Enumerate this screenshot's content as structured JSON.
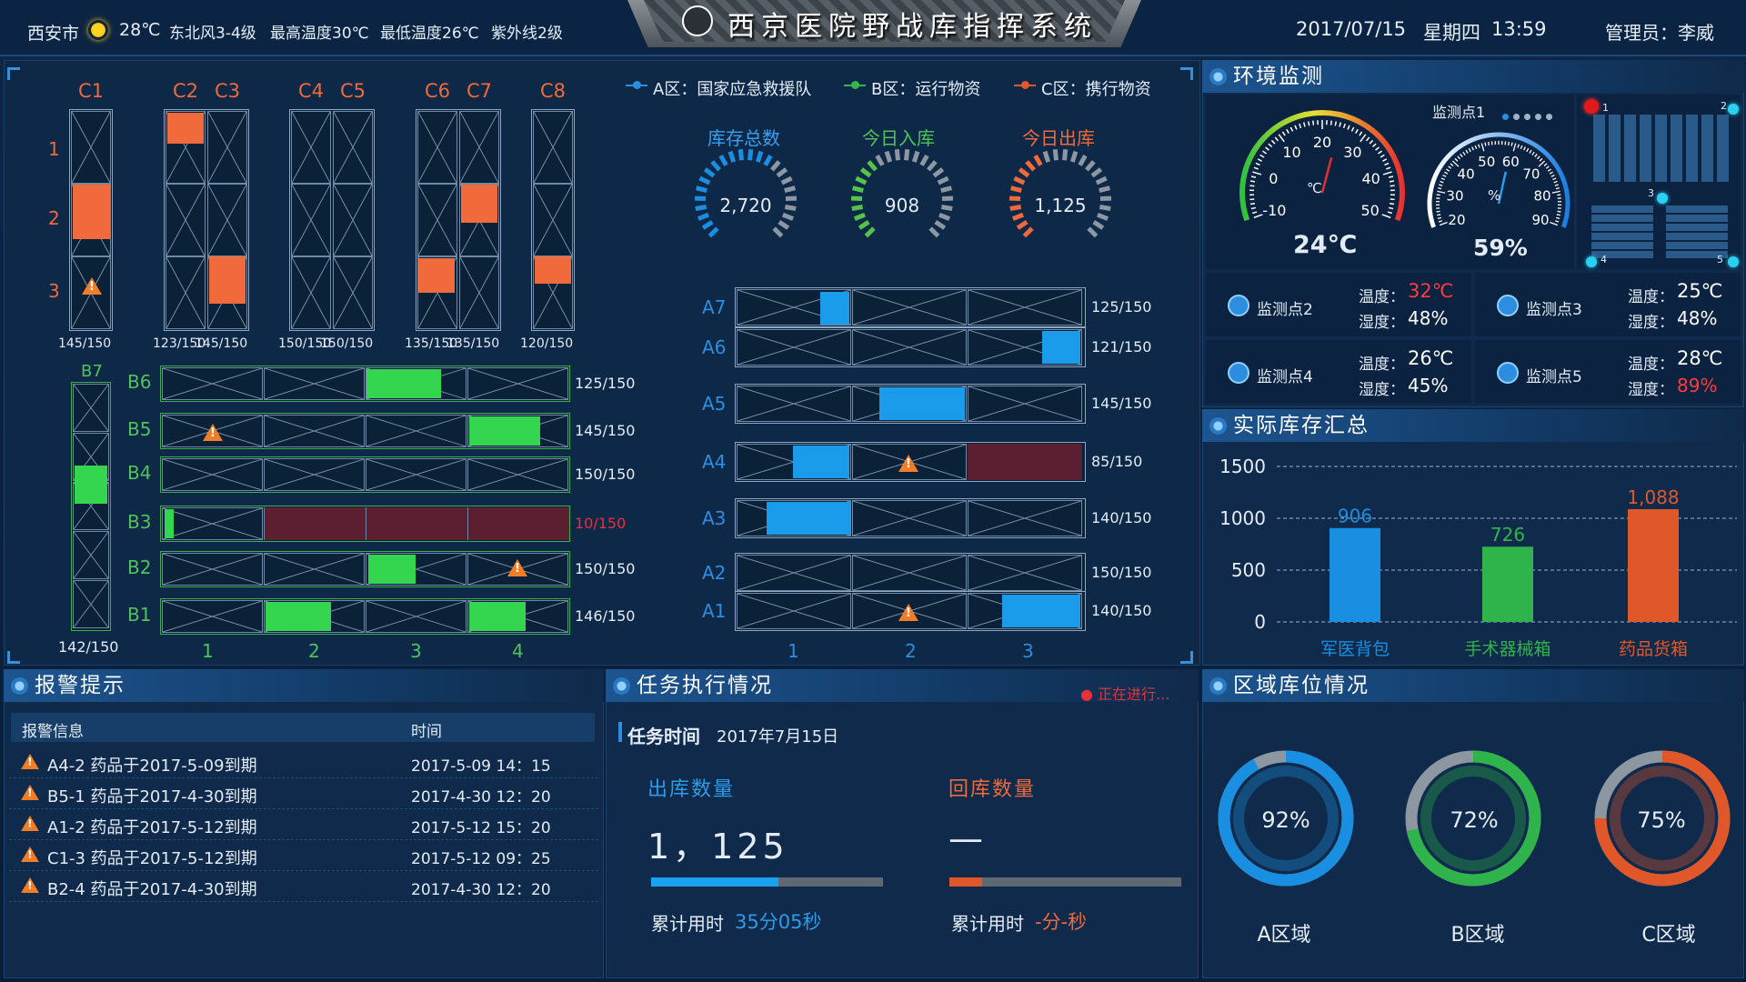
{
  "header": {
    "city": "西安市",
    "temp": "28℃",
    "wind": "东北风3-4级",
    "max": "最高温度30℃",
    "min": "最低温度26℃",
    "uv": "紫外线2级",
    "title": "西京医院野战库指挥系统",
    "date": "2017/07/15",
    "weekday": "星期四",
    "time": "13:59",
    "admin": "管理员：李威"
  },
  "legend": {
    "a": "A区：国家应急救援队",
    "b": "B区：运行物资",
    "c": "C区：携行物资"
  },
  "c_racks": {
    "top_labels": [
      "C1",
      "C2",
      "C3",
      "C4",
      "C5",
      "C6",
      "C7",
      "C8"
    ],
    "row_labels": [
      "1",
      "2",
      "3"
    ],
    "caps": [
      "145/150",
      "123/150",
      "145/150",
      "150/150",
      "150/150",
      "135/150",
      "135/150",
      "120/150"
    ]
  },
  "b_rows": {
    "labels": [
      "B6",
      "B5",
      "B4",
      "B3",
      "B2",
      "B1"
    ],
    "caps": [
      "125/150",
      "145/150",
      "150/150",
      "10/150",
      "150/150",
      "146/150"
    ],
    "col_labels": [
      "1",
      "2",
      "3",
      "4"
    ],
    "b7": "B7",
    "b7_cap": "142/150"
  },
  "a_rows": {
    "labels": [
      "A7",
      "A6",
      "A5",
      "A4",
      "A3",
      "A2",
      "A1"
    ],
    "caps": [
      "125/150",
      "121/150",
      "145/150",
      "85/150",
      "140/150",
      "150/150",
      "140/150"
    ],
    "col_labels": [
      "1",
      "2",
      "3"
    ]
  },
  "kpi": {
    "total_label": "库存总数",
    "total": "2,720",
    "in_label": "今日入库",
    "in": "908",
    "out_label": "今日出库",
    "out": "1,125"
  },
  "env": {
    "title": "环境监测",
    "point": "监测点1",
    "temp": "24℃",
    "humid": "59%",
    "temp_ticks": [
      "-10",
      "0",
      "10",
      "20",
      "30",
      "40",
      "50"
    ],
    "temp_unit": "℃",
    "hum_ticks": [
      "20",
      "30",
      "40",
      "50",
      "60",
      "70",
      "80",
      "90"
    ],
    "hum_unit": "%",
    "map_labels": [
      "1",
      "2",
      "3",
      "4",
      "5"
    ],
    "points": [
      {
        "name": "监测点2",
        "t_label": "温度：",
        "t": "32℃",
        "h_label": "湿度：",
        "h": "48%",
        "t_color": "#ff3b3b",
        "h_color": "#ffffff"
      },
      {
        "name": "监测点3",
        "t_label": "温度：",
        "t": "25℃",
        "h_label": "湿度：",
        "h": "48%",
        "t_color": "#ffffff",
        "h_color": "#ffffff"
      },
      {
        "name": "监测点4",
        "t_label": "温度：",
        "t": "26℃",
        "h_label": "湿度：",
        "h": "45%",
        "t_color": "#ffffff",
        "h_color": "#ffffff"
      },
      {
        "name": "监测点5",
        "t_label": "温度：",
        "t": "28℃",
        "h_label": "湿度：",
        "h": "89%",
        "t_color": "#ffffff",
        "h_color": "#ff3b3b"
      }
    ]
  },
  "inventory": {
    "title": "实际库存汇总"
  },
  "chart_data": {
    "type": "bar",
    "categories": [
      "军医背包",
      "手术器械箱",
      "药品货箱"
    ],
    "values": [
      906,
      726,
      1088
    ],
    "value_labels": [
      "906",
      "726",
      "1,088"
    ],
    "colors": [
      "#1a8ee0",
      "#2fb34b",
      "#e0572a"
    ],
    "yticks": [
      "0",
      "500",
      "1000",
      "1500"
    ],
    "ylim": [
      0,
      1500
    ]
  },
  "alarm": {
    "title": "报警提示",
    "col_info": "报警信息",
    "col_time": "时间",
    "rows": [
      {
        "info": "A4-2 药品于2017-5-09到期",
        "time": "2017-5-09 14：15"
      },
      {
        "info": "B5-1 药品于2017-4-30到期",
        "time": "2017-4-30 12：20"
      },
      {
        "info": "A1-2 药品于2017-5-12到期",
        "time": "2017-5-12 15：20"
      },
      {
        "info": "C1-3 药品于2017-5-12到期",
        "time": "2017-5-12 09：25"
      },
      {
        "info": "B2-4 药品于2017-4-30到期",
        "time": "2017-4-30 12：20"
      }
    ]
  },
  "task": {
    "title": "任务执行情况",
    "status": "● 正在进行...",
    "time_label": "任务时间",
    "time_val": "2017年7月15日",
    "out_label": "出库数量",
    "out_val": "1，125",
    "out_progress": 0.55,
    "back_label": "回库数量",
    "back_val": "—",
    "back_progress": 0.14,
    "out_used_label": "累计用时",
    "out_used": "35分05秒",
    "back_used_label": "累计用时",
    "back_used": "-分-秒"
  },
  "zone": {
    "title": "区域库位情况",
    "items": [
      {
        "pct": "92%",
        "name": "A区域",
        "value": 0.92,
        "color": "#1a8ee0"
      },
      {
        "pct": "72%",
        "name": "B区域",
        "value": 0.72,
        "color": "#2fb34b"
      },
      {
        "pct": "75%",
        "name": "C区域",
        "value": 0.75,
        "color": "#e0572a"
      }
    ]
  }
}
